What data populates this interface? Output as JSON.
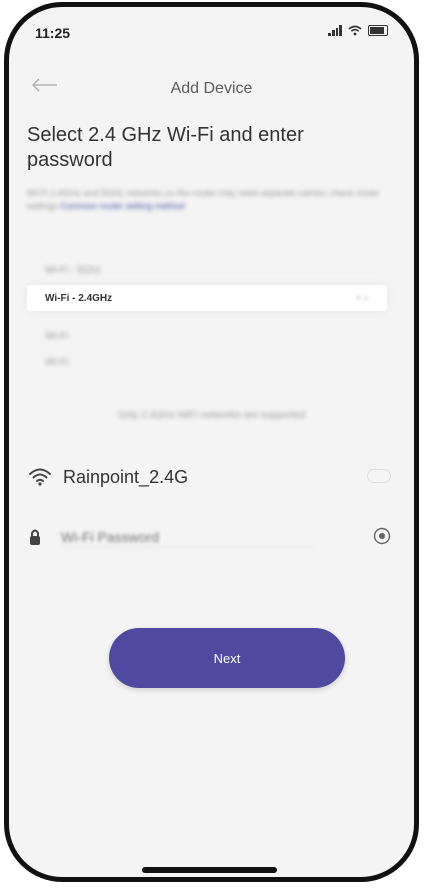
{
  "status_bar": {
    "time": "11:25"
  },
  "nav": {
    "title": "Add Device"
  },
  "heading": "Select 2.4 GHz Wi-Fi and enter password",
  "description": {
    "text": "Wi-Fi 2.4GHz and 5GHz networks on the router may need separate names; check router settings",
    "link": "Common router setting method"
  },
  "networks": {
    "rows": [
      {
        "name": "Wi-Fi - 5Ghz",
        "meta": ""
      },
      {
        "name": "Wi-Fi - 2.4GHz",
        "meta": ""
      },
      {
        "name": "Wi-Fi",
        "meta": ""
      },
      {
        "name": "Wi-Fi",
        "meta": ""
      }
    ]
  },
  "support_note": "Only 2.4GHz WiFi networks are supported",
  "ssid": {
    "label": "Rainpoint_2.4G"
  },
  "password": {
    "placeholder": "Wi-Fi Password"
  },
  "actions": {
    "next_label": "Next"
  },
  "colors": {
    "accent": "#4f4aa0",
    "text": "#333333",
    "muted": "#9c9c9c"
  }
}
